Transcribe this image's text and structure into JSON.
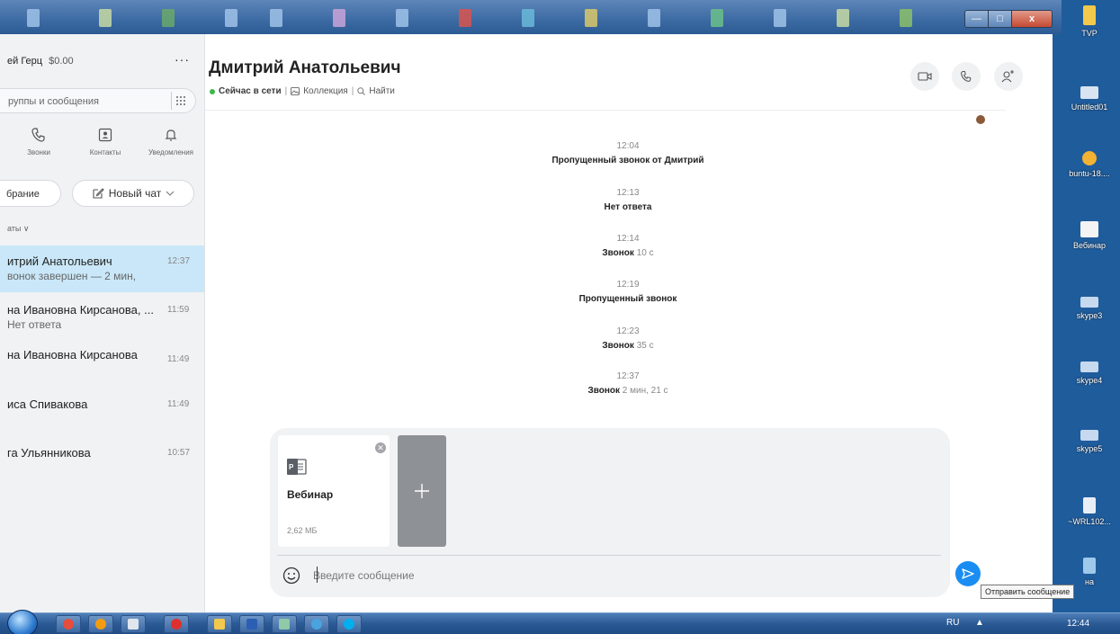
{
  "left": {
    "profile_name": "ей Герц",
    "profile_balance": "$0.00",
    "more_label": "···",
    "search_placeholder": "руппы и сообщения",
    "nav": [
      {
        "label": "Звонки"
      },
      {
        "label": "Контакты"
      },
      {
        "label": "Уведомления"
      }
    ],
    "pill_left": "брание",
    "new_chat": "Новый чат",
    "chats_header": "аты ∨",
    "chats": [
      {
        "name": "итрий Анатольевич",
        "preview": "вонок завершен — 2 мин,",
        "time": "12:37"
      },
      {
        "name": "на Ивановна Кирсанова, ...",
        "preview": "Нет ответа",
        "time": "11:59"
      },
      {
        "name": "на Ивановна Кирсанова",
        "preview": "",
        "time": "11:49"
      },
      {
        "name": "иса Спивакова",
        "preview": "",
        "time": "11:49"
      },
      {
        "name": "га Ульянникова",
        "preview": "",
        "time": "10:57"
      }
    ]
  },
  "conversation": {
    "title": "Дмитрий Анатольевич",
    "status": "Сейчас в сети",
    "collection": "Коллекция",
    "find": "Найти",
    "events": [
      {
        "time": "12:04",
        "label": "Пропущенный звонок от Дмитрий",
        "detail": ""
      },
      {
        "time": "12:13",
        "label": "Нет ответа",
        "detail": ""
      },
      {
        "time": "12:14",
        "label": "Звонок",
        "detail": "10 с"
      },
      {
        "time": "12:19",
        "label": "Пропущенный звонок",
        "detail": ""
      },
      {
        "time": "12:23",
        "label": "Звонок",
        "detail": "35 с"
      },
      {
        "time": "12:37",
        "label": "Звонок",
        "detail": "2 мин, 21 с"
      }
    ]
  },
  "composer": {
    "file_name": "Вебинар",
    "file_size": "2,62 МБ",
    "placeholder": "Введите сообщение",
    "send_tooltip": "Отправить сообщение"
  },
  "window": {
    "controls": [
      "—",
      "□",
      "x"
    ]
  },
  "desktop": {
    "icons": [
      {
        "label": "TVP",
        "color": "#f2c94c"
      },
      {
        "label": "Untitled01",
        "color": "#d8e4f2"
      },
      {
        "label": "buntu-18....",
        "color": "#f2b233"
      },
      {
        "label": "Вебинар",
        "color": "#f4f4f4"
      },
      {
        "label": "skype3",
        "color": "#c7d9ee"
      },
      {
        "label": "skype4",
        "color": "#c7d9ee"
      },
      {
        "label": "skype5",
        "color": "#c7d9ee"
      },
      {
        "label": "~WRL102...",
        "color": "#e8eef6"
      },
      {
        "label": "на",
        "color": "#9ec9ea"
      }
    ]
  },
  "taskbar": {
    "lang": "RU",
    "tray_arrow": "▲",
    "clock": "12:44"
  },
  "colors": {
    "accent": "#1a8df2",
    "online": "#3cb84a",
    "active_chat": "#c9e7f8"
  }
}
